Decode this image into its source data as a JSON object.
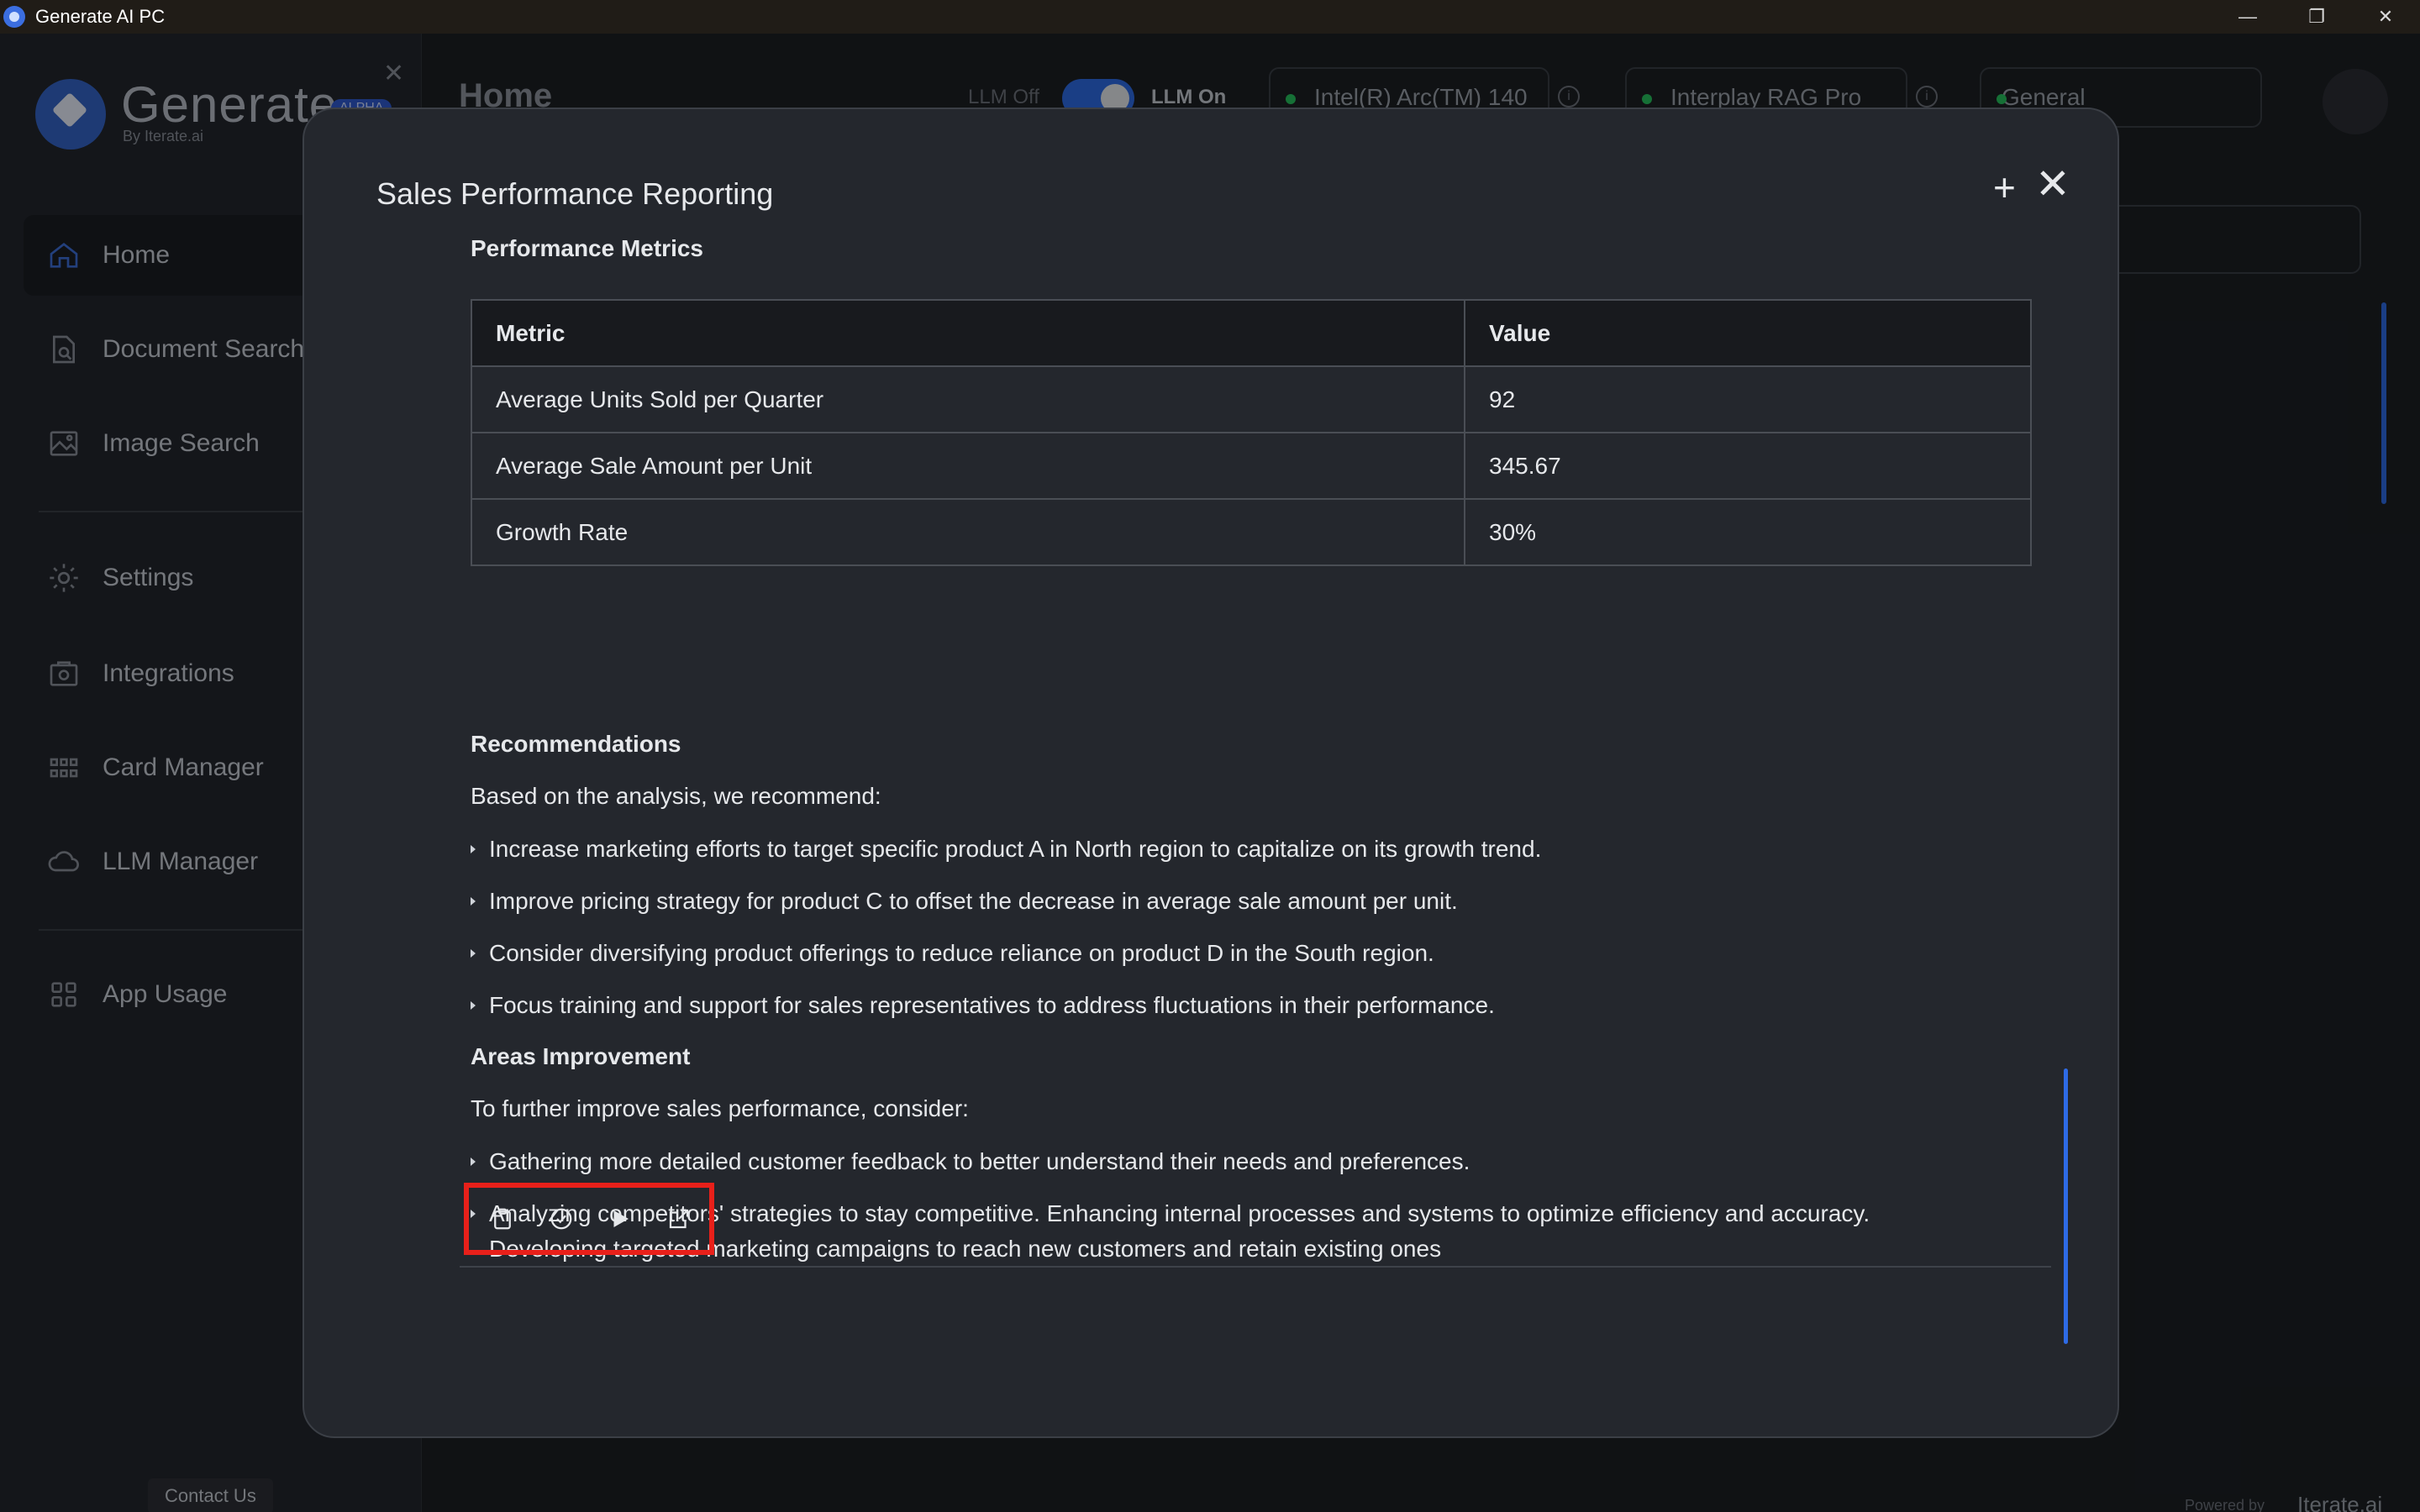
{
  "window": {
    "title": "Generate AI PC"
  },
  "brand": {
    "name": "Generate",
    "sub": "By Iterate.ai",
    "badge": "ALPHA"
  },
  "sidebar": {
    "items": [
      {
        "label": "Home",
        "icon": "home-icon"
      },
      {
        "label": "Document Search",
        "icon": "document-search-icon"
      },
      {
        "label": "Image Search",
        "icon": "image-search-icon"
      },
      {
        "label": "Settings",
        "icon": "gear-icon"
      },
      {
        "label": "Integrations",
        "icon": "integrations-icon"
      },
      {
        "label": "Card Manager",
        "icon": "grid-icon"
      },
      {
        "label": "LLM Manager",
        "icon": "cloud-icon"
      },
      {
        "label": "App Usage",
        "icon": "apps-icon"
      }
    ],
    "contact": "Contact Us"
  },
  "topbar": {
    "page_title": "Home",
    "llm_off": "LLM Off",
    "llm_on": "LLM On",
    "device": "Intel(R) Arc(TM) 140",
    "rag": "Interplay RAG Pro",
    "mode": "General"
  },
  "footer": {
    "powered": "Powered by",
    "logo": "Iterate.ai"
  },
  "modal": {
    "title": "Sales Performance Reporting",
    "metrics_heading": "Performance Metrics",
    "table": {
      "headers": [
        "Metric",
        "Value"
      ],
      "rows": [
        [
          "Average Units Sold per Quarter",
          "92"
        ],
        [
          "Average Sale Amount per Unit",
          "345.67"
        ],
        [
          "Growth Rate",
          "30%"
        ]
      ]
    },
    "recommendations_heading": "Recommendations",
    "recommendations_intro": "Based on the analysis, we recommend:",
    "recommendations": [
      "Increase marketing efforts to target specific product A in North region to capitalize on its growth trend.",
      "Improve pricing strategy for product C to offset the decrease in average sale amount per unit.",
      "Consider diversifying product offerings to reduce reliance on product D in the South region.",
      "Focus training and support for sales representatives to address fluctuations in their performance."
    ],
    "areas_heading": "Areas Improvement",
    "areas_intro": "To further improve sales performance, consider:",
    "areas": [
      "Gathering more detailed customer feedback to better understand their needs and preferences.",
      "Analyzing competitors' strategies to stay competitive. Enhancing internal processes and systems to optimize efficiency and accuracy.",
      "Developing targeted marketing campaigns to reach new customers and retain existing ones"
    ],
    "actions": [
      "clipboard-icon",
      "feedback-icon",
      "play-icon",
      "share-icon"
    ]
  },
  "colors": {
    "accent": "#2e6be6",
    "highlight_box": "#e8201a",
    "status_dot": "#27c25d"
  }
}
